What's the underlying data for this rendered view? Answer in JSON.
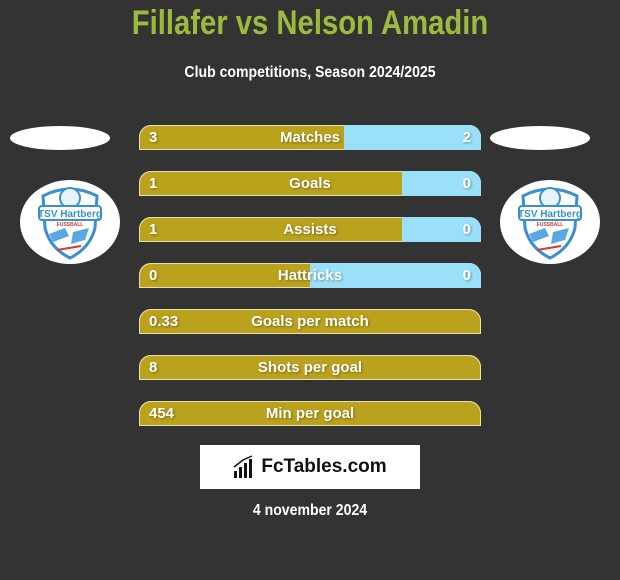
{
  "header": {
    "title": "Fillafer vs Nelson Amadin",
    "subtitle": "Club competitions, Season 2024/2025"
  },
  "teams": {
    "left": {
      "player": "Fillafer",
      "club_logo_text": "TSV Hartberg",
      "club_logo_subtext": "FUSSBALL"
    },
    "right": {
      "player": "Nelson Amadin",
      "club_logo_text": "TSV Hartberg",
      "club_logo_subtext": "FUSSBALL"
    }
  },
  "colors": {
    "left_bar": "#bba21c",
    "right_bar": "#99e0f8",
    "title": "#9bbb3c",
    "background": "#333333"
  },
  "stats": [
    {
      "label": "Matches",
      "left": "3",
      "right": "2",
      "right_share": 0.4
    },
    {
      "label": "Goals",
      "left": "1",
      "right": "0",
      "right_share": 0.23
    },
    {
      "label": "Assists",
      "left": "1",
      "right": "0",
      "right_share": 0.23
    },
    {
      "label": "Hattricks",
      "left": "0",
      "right": "0",
      "right_share": 0.5
    },
    {
      "label": "Goals per match",
      "left": "0.33",
      "right": "",
      "right_share": 0
    },
    {
      "label": "Shots per goal",
      "left": "8",
      "right": "",
      "right_share": 0
    },
    {
      "label": "Min per goal",
      "left": "454",
      "right": "",
      "right_share": 0
    }
  ],
  "footer": {
    "brand": "FcTables.com",
    "date": "4 november 2024"
  }
}
